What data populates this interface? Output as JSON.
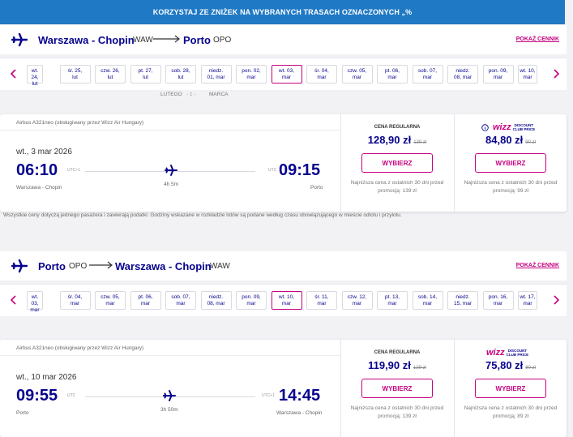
{
  "banner": {
    "text": "KORZYSTAJ ZE ZNIŻEK NA WYBRANYCH TRASACH OZNACZONYCH „%"
  },
  "colors": {
    "brand": "#06038d",
    "accent": "#c6007e",
    "banner": "#1f79c4"
  },
  "outbound": {
    "from_city": "Warszawa - Chopin",
    "from_code": "WAW",
    "to_city": "Porto",
    "to_code": "OPO",
    "show_prices_link": "POKAŻ CENNIK",
    "dates": [
      {
        "line1": "wt. 24,",
        "line2": "lut"
      },
      {
        "line1": "śr. 25,",
        "line2": "lut"
      },
      {
        "line1": "czw. 26,",
        "line2": "lut"
      },
      {
        "line1": "pt. 27,",
        "line2": "lut"
      },
      {
        "line1": "sob. 28,",
        "line2": "lut"
      },
      {
        "line1": "niedz.",
        "line2": "01, mar"
      },
      {
        "line1": "pon. 02,",
        "line2": "mar"
      },
      {
        "line1": "wt. 03,",
        "line2": "mar"
      },
      {
        "line1": "śr. 04,",
        "line2": "mar"
      },
      {
        "line1": "czw. 05,",
        "line2": "mar"
      },
      {
        "line1": "pt. 06,",
        "line2": "mar"
      },
      {
        "line1": "sob. 07,",
        "line2": "mar"
      },
      {
        "line1": "niedz.",
        "line2": "08, mar"
      },
      {
        "line1": "pon. 09,",
        "line2": "mar"
      },
      {
        "line1": "wt. 10,",
        "line2": "mar"
      }
    ],
    "month_left": "LUTEGO",
    "month_right": "MARCA",
    "aircraft": "Airbus A321neo (obsługiwany przez Wizz Air Hungary)",
    "day_label": "wt., 3 mar 2026",
    "dep_time": "06:10",
    "dep_tz": "UTC+1",
    "arr_time": "09:15",
    "arr_tz": "UTC",
    "duration": "4h 5m",
    "dep_place": "Warszawa - Chopin",
    "arr_place": "Porto",
    "regular": {
      "title": "CENA REGULARNA",
      "price": "128,90 zł",
      "old": "139 zł",
      "button": "WYBIERZ",
      "note": "Najniższa cena z ostatnich 30 dni przed promocją: 139 zł"
    },
    "club": {
      "logo_main": "wizz",
      "logo_line1": "DISCOUNT",
      "logo_line2": "CLUB PRICE",
      "price": "84,80 zł",
      "old": "90 zł",
      "button": "WYBIERZ",
      "note": "Najniższa cena z ostatnich 30 dni przed promocją: 99 zł"
    }
  },
  "disclaimer": "Wszystkie ceny dotyczą jednego pasażera i zawierają podatki. Godziny wskazane w rozkładzie lotów są podane według czasu obowiązującego w mieście odlotu i przylotu.",
  "inbound": {
    "from_city": "Porto",
    "from_code": "OPO",
    "to_city": "Warszawa - Chopin",
    "to_code": "WAW",
    "show_prices_link": "POKAŻ CENNIK",
    "dates": [
      {
        "line1": "wt. 03,",
        "line2": "mar"
      },
      {
        "line1": "śr. 04,",
        "line2": "mar"
      },
      {
        "line1": "czw. 05,",
        "line2": "mar"
      },
      {
        "line1": "pt. 06,",
        "line2": "mar"
      },
      {
        "line1": "sob. 07,",
        "line2": "mar"
      },
      {
        "line1": "niedz.",
        "line2": "08, mar"
      },
      {
        "line1": "pon. 09,",
        "line2": "mar"
      },
      {
        "line1": "wt. 10,",
        "line2": "mar"
      },
      {
        "line1": "śr. 11,",
        "line2": "mar"
      },
      {
        "line1": "czw. 12,",
        "line2": "mar"
      },
      {
        "line1": "pt. 13,",
        "line2": "mar"
      },
      {
        "line1": "sob. 14,",
        "line2": "mar"
      },
      {
        "line1": "niedz.",
        "line2": "15, mar"
      },
      {
        "line1": "pon. 16,",
        "line2": "mar"
      },
      {
        "line1": "wt. 17,",
        "line2": "mar"
      }
    ],
    "aircraft": "Airbus A321neo (obsługiwany przez Wizz Air Hungary)",
    "day_label": "wt., 10 mar 2026",
    "dep_time": "09:55",
    "dep_tz": "UTC",
    "arr_time": "14:45",
    "arr_tz": "UTC+1",
    "duration": "3h 50m",
    "dep_place": "Porto",
    "arr_place": "Warszawa - Chopin",
    "regular": {
      "title": "CENA REGULARNA",
      "price": "119,90 zł",
      "old": "129 zł",
      "button": "WYBIERZ",
      "note": "Najniższa cena z ostatnich 30 dni przed promocją: 139 zł"
    },
    "club": {
      "logo_main": "wizz",
      "logo_line1": "DISCOUNT",
      "logo_line2": "CLUB PRICE",
      "price": "75,80 zł",
      "old": "80 zł",
      "button": "WYBIERZ",
      "note": "Najniższa cena z ostatnich 30 dni przed promocją: 89 zł"
    }
  }
}
